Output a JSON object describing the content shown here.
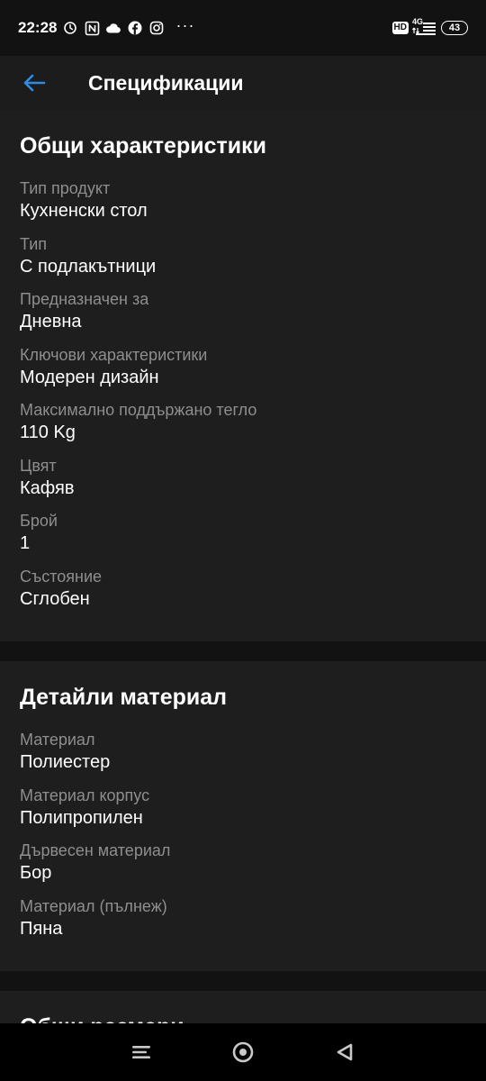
{
  "status_bar": {
    "time": "22:28",
    "net_type": "4G",
    "hd": "HD",
    "battery": "43",
    "more": "···"
  },
  "header": {
    "title": "Спецификации"
  },
  "sections": [
    {
      "title": "Общи характеристики",
      "specs": [
        {
          "label": "Тип продукт",
          "value": "Кухненски стол"
        },
        {
          "label": "Тип",
          "value": "С подлакътници"
        },
        {
          "label": "Предназначен за",
          "value": "Дневна"
        },
        {
          "label": "Ключови характеристики",
          "value": "Модерен дизайн"
        },
        {
          "label": "Максимално поддържано тегло",
          "value": "110 Kg"
        },
        {
          "label": "Цвят",
          "value": "Кафяв"
        },
        {
          "label": "Брой",
          "value": "1"
        },
        {
          "label": "Състояние",
          "value": "Сглобен"
        }
      ]
    },
    {
      "title": "Детайли материал",
      "specs": [
        {
          "label": "Материал",
          "value": "Полиестер"
        },
        {
          "label": "Материал корпус",
          "value": "Полипропилен"
        },
        {
          "label": "Дървесен материал",
          "value": "Бор"
        },
        {
          "label": "Материал (пълнеж)",
          "value": "Пяна"
        }
      ]
    },
    {
      "title": "Общи размери"
    }
  ],
  "colors": {
    "accent": "#2d8ae5",
    "background": "#121212",
    "card": "#1e1e1e",
    "label": "#8e8e8e",
    "text": "#ffffff"
  },
  "icons": {
    "back": "arrow-left-icon",
    "nav_menu": "menu-icon",
    "nav_home": "home-circle-icon",
    "nav_back": "triangle-back-icon"
  }
}
